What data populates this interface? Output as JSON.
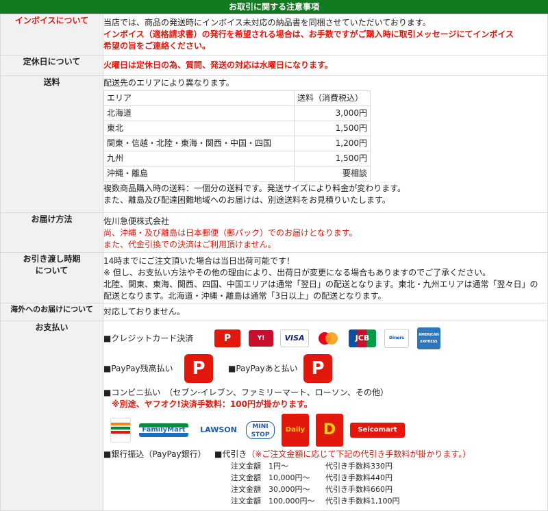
{
  "title": "お取引に関する注意事項",
  "sections": {
    "invoice": {
      "label": "インボイスについて",
      "line1": "当店では、商品の発送時にインボイス未対応の納品書を同梱させていただいております。",
      "line2": "インボイス（適格請求書）の発行を希望される場合は、お手数ですがご購入時に取引メッセージにてインボイス",
      "line3": "希望の旨をご連絡ください。"
    },
    "holiday": {
      "label": "定休日について",
      "text": "火曜日は定休日の為、質問、発送の対応は水曜日になります。"
    },
    "shipping": {
      "label": "送料",
      "intro": "配送先のエリアにより異なります。",
      "header_area": "エリア",
      "header_fee": "送料（消費税込）",
      "rows": [
        {
          "area": "北海道",
          "fee": "3,000円"
        },
        {
          "area": "東北",
          "fee": "1,500円"
        },
        {
          "area": "関東・信越・北陸・東海・関西・中国・四国",
          "fee": "1,200円"
        },
        {
          "area": "九州",
          "fee": "1,500円"
        },
        {
          "area": "沖縄・離島",
          "fee": "要相談"
        }
      ],
      "note1": "複数商品購入時の送料：一個分の送料です。発送サイズにより料金が変わります。",
      "note2": "また、離島及び配達困難地域へのお届けは、別途送料をお見積りいたします。"
    },
    "delivery": {
      "label": "お届け方法",
      "line1": "佐川急便株式会社",
      "line2": "尚、沖縄・及び離島は日本郵便（郵パック）でのお届けとなります。",
      "line3": "また、代金引換での決済はご利用頂けません。"
    },
    "handover": {
      "label1": "お引き渡し時期",
      "label2": "について",
      "line1": "14時までにご注文頂いた場合は当日出荷可能です！",
      "line2": "※ 但し、お支払い方法やその他の理由により、出荷日が変更になる場合もありますのでご了承ください。",
      "line3": "北陸、関東、東海、関西、四国、中国エリアは通常「翌日」の配送となります。東北・九州エリアは通常「翌々日」の",
      "line4": "配送となります。北海道・沖縄・離島は通常「3日以上」の配送となります。"
    },
    "overseas": {
      "label": "海外へのお届けについて",
      "text": "対応しておりません。"
    },
    "payment": {
      "label": "お支払い",
      "credit": "■クレジットカード決済",
      "card_logos": [
        "VISA",
        "JCB",
        "Diners Club",
        "AMERICAN EXPRESS"
      ],
      "paypay_balance": "■PayPay残高払い",
      "paypay_later": "■PayPayあと払い",
      "conbini": "■コンビニ払い　（セブン-イレブン、ファミリーマート、ローソン、その他）",
      "conbini_fee": "※別途、ヤフオク!決済手数料：100円が掛かります。",
      "store_logos": [
        "FamilyMart",
        "LAWSON",
        "MINI STOP",
        "Daily",
        "Seicomart"
      ],
      "bank": "■銀行振込（PayPay銀行）",
      "cod_title": "■代引き",
      "cod_note": "（※ご注文金額に応じて下記の代引き手数料が掛かります。）",
      "cod_rows": [
        {
          "amount": "注文金額　1円～",
          "fee": "代引き手数料330円"
        },
        {
          "amount": "注文金額　10,000円～",
          "fee": "代引き手数料440円"
        },
        {
          "amount": "注文金額　30,000円～",
          "fee": "代引き手数料660円"
        },
        {
          "amount": "注文金額　100,000円～",
          "fee": "代引き手数料1,100円"
        }
      ]
    }
  }
}
